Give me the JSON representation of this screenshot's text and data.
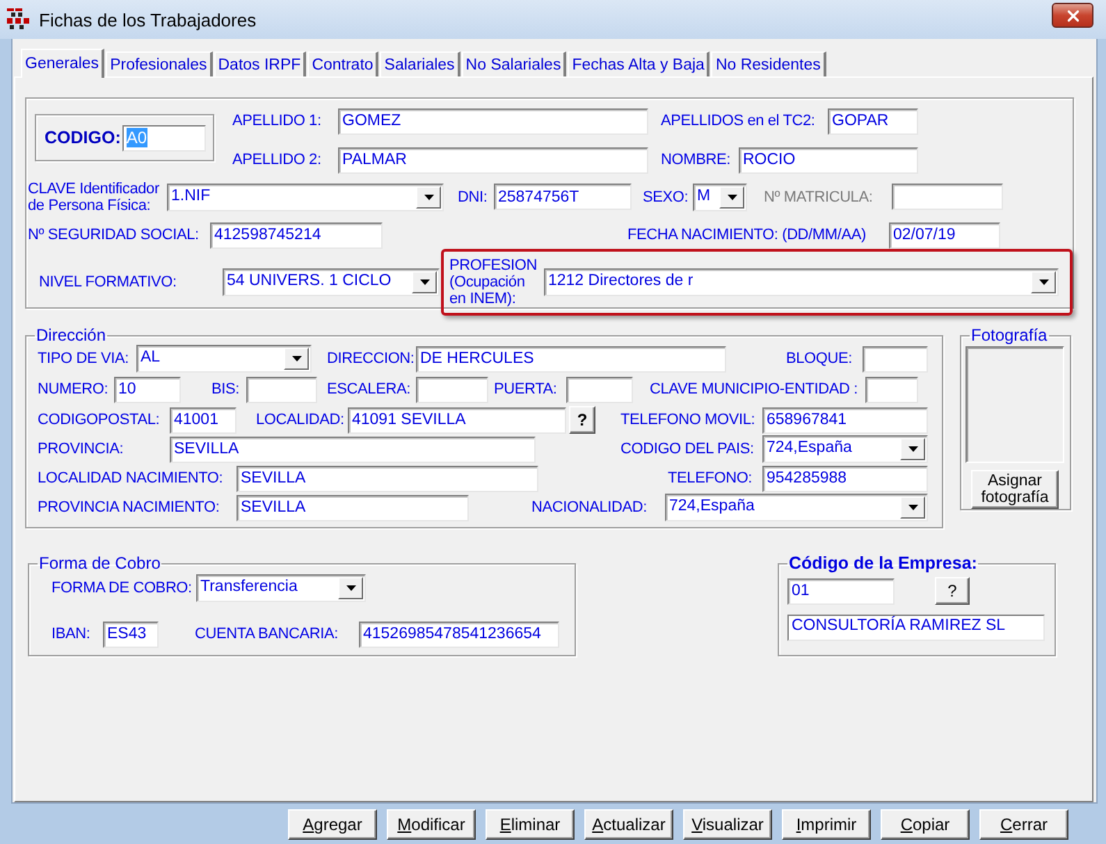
{
  "window": {
    "title": "Fichas de los Trabajadores"
  },
  "tabs": [
    {
      "label": "Generales",
      "selected": true
    },
    {
      "label": "Profesionales",
      "selected": false
    },
    {
      "label": "Datos IRPF",
      "selected": false
    },
    {
      "label": "Contrato",
      "selected": false
    },
    {
      "label": "Salariales",
      "selected": false
    },
    {
      "label": "No Salariales",
      "selected": false
    },
    {
      "label": "Fechas Alta y Baja",
      "selected": false
    },
    {
      "label": "No Residentes",
      "selected": false
    }
  ],
  "personal": {
    "codigo": {
      "label": "CODIGO:",
      "value": "A0",
      "value_selected": true
    },
    "apellido1": {
      "kind": "text",
      "label": "APELLIDO 1:",
      "value": "GOMEZ"
    },
    "apellidos_tc2": {
      "kind": "text",
      "label": "APELLIDOS en el TC2:",
      "value": "GOPAR"
    },
    "apellido2": {
      "kind": "text",
      "label": "APELLIDO 2:",
      "value": "PALMAR"
    },
    "nombre": {
      "kind": "text",
      "label": "NOMBRE:",
      "value": "ROCIO"
    },
    "clave": {
      "kind": "select",
      "label": "CLAVE Identificador de Persona Física:",
      "value": "1.NIF"
    },
    "dni": {
      "kind": "text",
      "label": "DNI:",
      "value": "25874756T"
    },
    "sexo": {
      "kind": "select",
      "label": "SEXO:",
      "value": "M"
    },
    "matricula": {
      "kind": "text",
      "label": "Nº MATRICULA:",
      "disabled": true
    },
    "seguridad_social": {
      "kind": "text",
      "label": "Nº SEGURIDAD SOCIAL:",
      "value": "412598745214"
    },
    "fecha_nacimiento": {
      "kind": "text",
      "label": "FECHA NACIMIENTO: (DD/MM/AA)",
      "value": "02/07/19"
    },
    "nivel_formativo": {
      "kind": "select",
      "label": "NIVEL FORMATIVO:",
      "value": "54 UNIVERS. 1 CICLO"
    },
    "profesion": {
      "label": "PROFESION (Ocupación en INEM):",
      "value": "1212 Directores de r",
      "highlighted": true
    }
  },
  "direccion": {
    "title": "Dirección",
    "tipo_via": {
      "kind": "select",
      "label": "TIPO DE  VIA:",
      "value": "AL"
    },
    "direccion": {
      "kind": "text",
      "label": "DIRECCION:",
      "value": "DE HERCULES"
    },
    "bloque": {
      "kind": "text",
      "label": "BLOQUE:"
    },
    "numero": {
      "kind": "text",
      "label": "NUMERO:",
      "value": "10"
    },
    "bis": {
      "kind": "text",
      "label": "BIS:"
    },
    "escalera": {
      "kind": "text",
      "label": "ESCALERA:"
    },
    "puerta": {
      "kind": "text",
      "label": "PUERTA:"
    },
    "clave_municipio": {
      "kind": "text",
      "label": "CLAVE MUNICIPIO-ENTIDAD :"
    },
    "codigo_postal": {
      "kind": "text",
      "label": "CODIGOPOSTAL:",
      "value": "41001"
    },
    "localidad": {
      "kind": "text",
      "label": "LOCALIDAD:",
      "value": "41091 SEVILLA"
    },
    "localidad_lookup": "?",
    "telefono_movil": {
      "kind": "text",
      "label": "TELEFONO MOVIL:",
      "value": "658967841"
    },
    "provincia": {
      "kind": "text",
      "label": "PROVINCIA:",
      "value": "SEVILLA"
    },
    "codigo_pais": {
      "kind": "select",
      "label": "CODIGO DEL PAIS:",
      "value": "724,España"
    },
    "localidad_nacimiento": {
      "kind": "text",
      "label": "LOCALIDAD NACIMIENTO:",
      "value": "SEVILLA"
    },
    "telefono": {
      "kind": "text",
      "label": "TELEFONO:",
      "value": "954285988"
    },
    "provincia_nacimiento": {
      "kind": "text",
      "label": "PROVINCIA NACIMIENTO:",
      "value": "SEVILLA"
    },
    "nacionalidad": {
      "kind": "select",
      "label": "NACIONALIDAD:",
      "value": "724,España"
    }
  },
  "fotografia": {
    "title": "Fotografía",
    "button": "Asignar fotografía"
  },
  "forma_de_cobro": {
    "title": "Forma de Cobro",
    "forma": {
      "kind": "select",
      "label": "FORMA DE COBRO:",
      "value": "Transferencia"
    },
    "iban": {
      "kind": "text",
      "label": "IBAN:",
      "value": "ES43"
    },
    "cuenta": {
      "kind": "text",
      "label": "CUENTA BANCARIA:",
      "value": "41526985478541236654"
    }
  },
  "empresa": {
    "title": "Código de la Empresa:",
    "codigo": "01",
    "lookup_button": "?",
    "nombre": "CONSULTORÍA RAMIREZ SL"
  },
  "buttons": [
    "Agregar",
    "Modificar",
    "Eliminar",
    "Actualizar",
    "Visualizar",
    "Imprimir",
    "Copiar",
    "Cerrar"
  ]
}
